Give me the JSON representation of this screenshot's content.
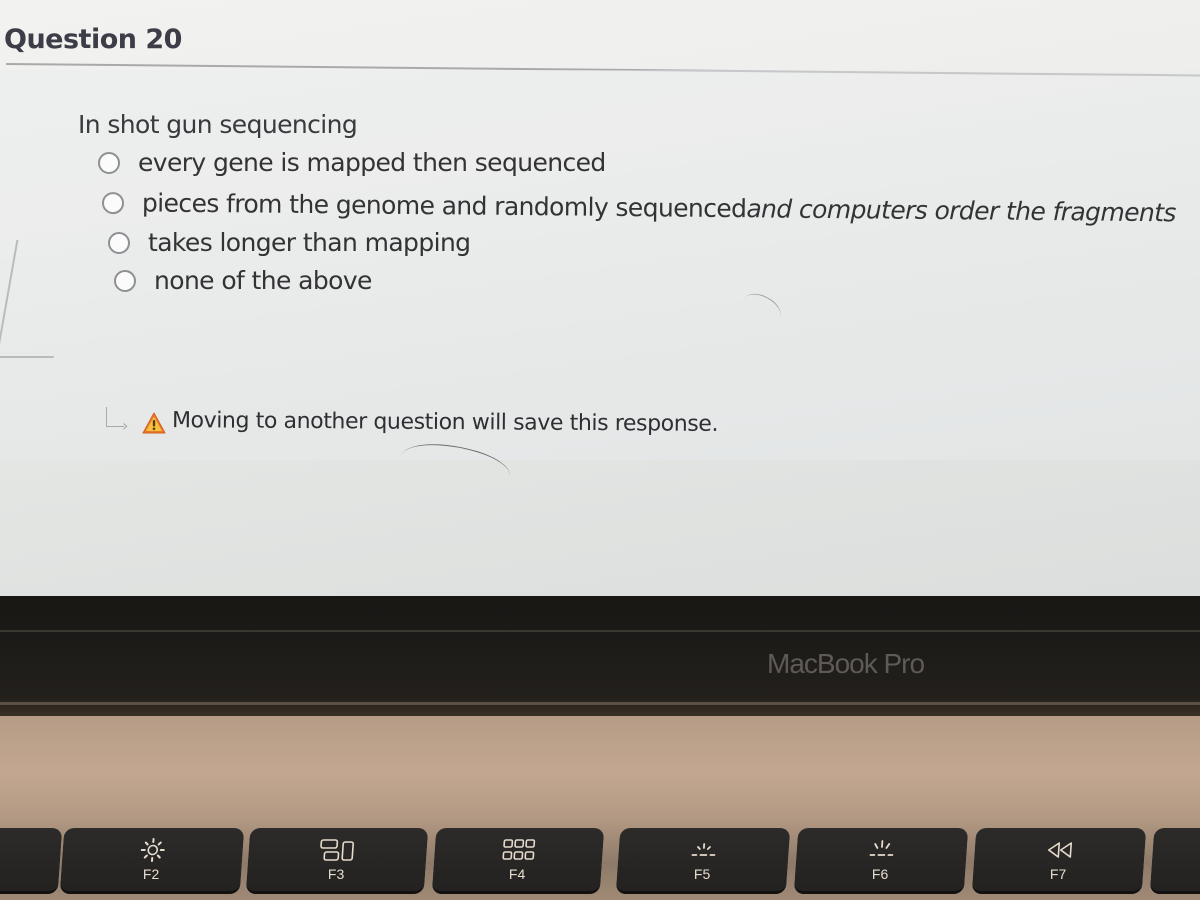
{
  "question": {
    "title": "Question 20",
    "prompt": "In shot gun sequencing",
    "options": [
      {
        "label": "every gene is mapped then sequenced",
        "selected": false
      },
      {
        "label_plain": "pieces from the genome and randomly sequenced",
        "label_italic": " and computers order the fragments",
        "label": "pieces from the genome and randomly sequenced and computers order the fragments",
        "selected": false
      },
      {
        "label": "takes longer than mapping",
        "selected": false
      },
      {
        "label": "none of the above",
        "selected": false
      }
    ],
    "notice": {
      "icon": "warning-icon",
      "text": "Moving to another question will save this response."
    }
  },
  "device": {
    "brand_label": "MacBook Pro"
  },
  "keyboard": {
    "keys": [
      {
        "label": "F2",
        "icon": "brightness-up-icon"
      },
      {
        "label": "F3",
        "icon": "mission-control-icon"
      },
      {
        "label": "F4",
        "icon": "launchpad-icon"
      },
      {
        "label": "F5",
        "icon": "keyboard-backlight-down-icon"
      },
      {
        "label": "F6",
        "icon": "keyboard-backlight-up-icon"
      },
      {
        "label": "F7",
        "icon": "rewind-icon"
      }
    ]
  },
  "colors": {
    "warning": "#e8792c",
    "text": "#333336",
    "key_legend": "#e6dccd"
  }
}
